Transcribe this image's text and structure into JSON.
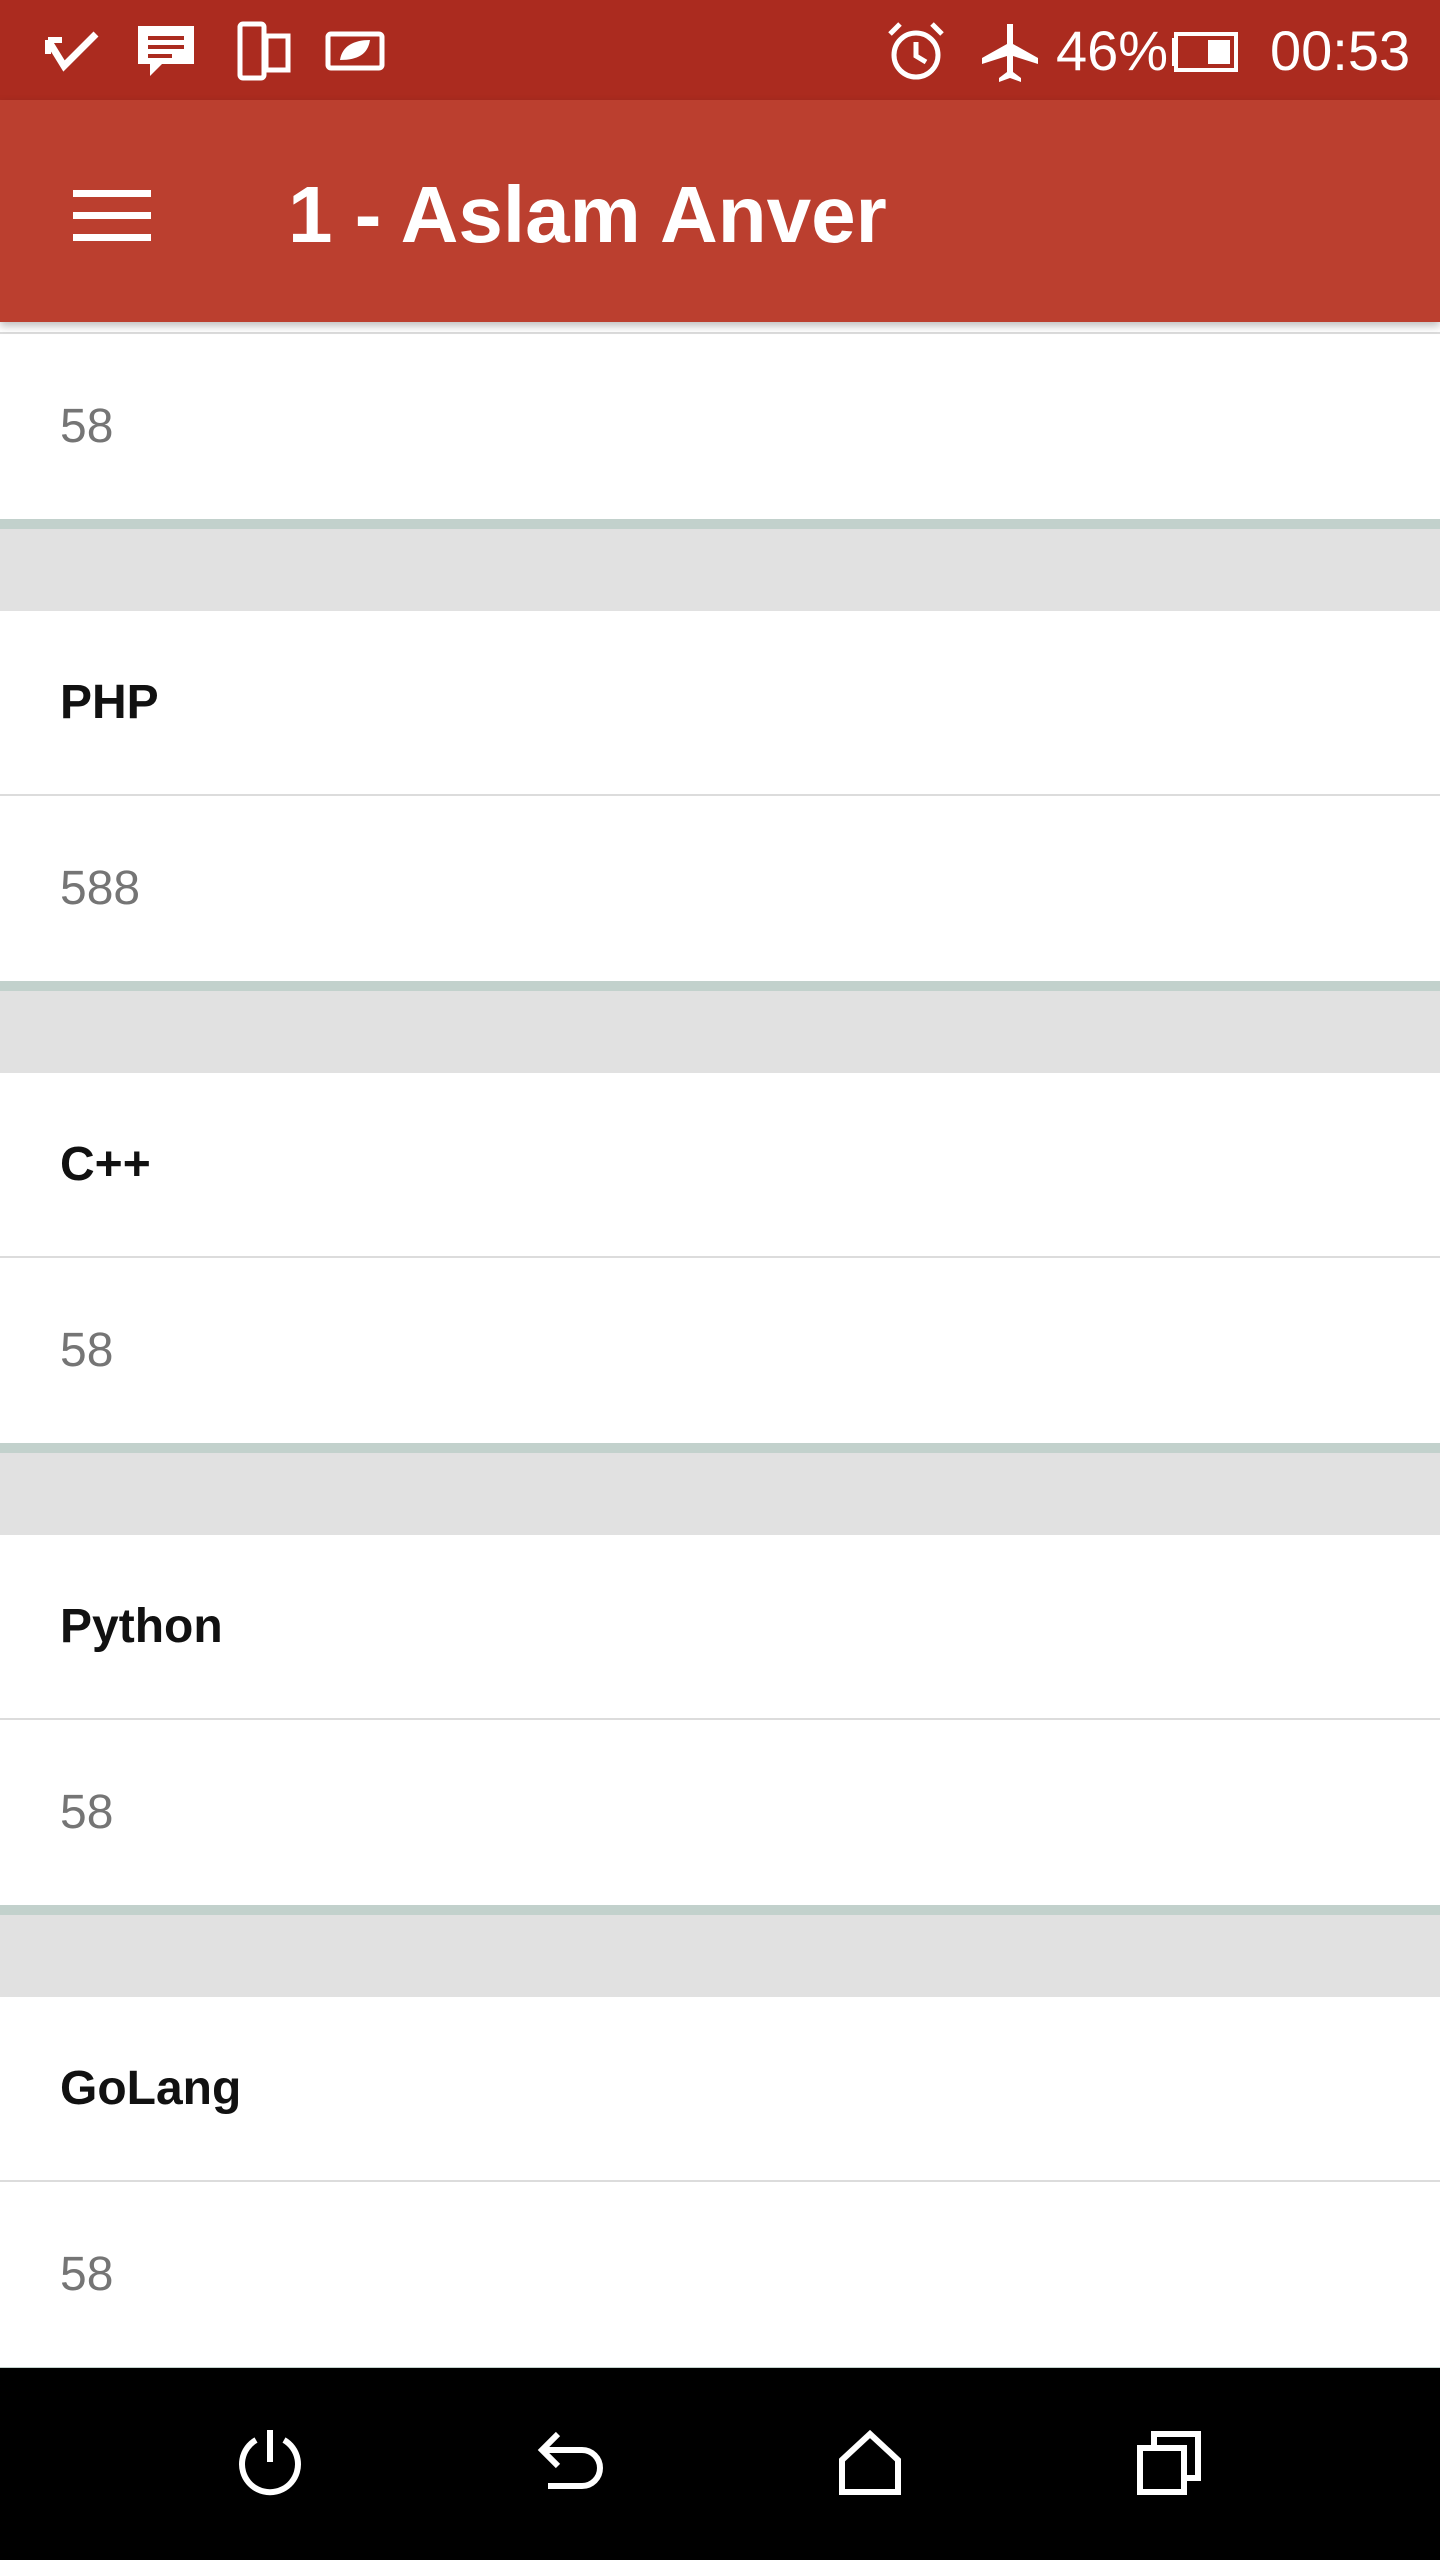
{
  "status_bar": {
    "icons": [
      "download-done-icon",
      "message-icon",
      "devices-icon",
      "power-saver-icon",
      "alarm-icon",
      "airplane-mode-icon",
      "battery-icon"
    ],
    "battery_percent": "46%",
    "battery_level": 0.46,
    "time": "00:53"
  },
  "app_bar": {
    "menu_icon": "hamburger-menu-icon",
    "title": "1 - Aslam Anver"
  },
  "list": {
    "items": [
      {
        "name": "",
        "value": "58"
      },
      {
        "name": "PHP",
        "value": "588"
      },
      {
        "name": "C++",
        "value": "58"
      },
      {
        "name": "Python",
        "value": "58"
      },
      {
        "name": "GoLang",
        "value": "58"
      }
    ]
  },
  "nav_bar": {
    "icons": [
      "power-icon",
      "back-icon",
      "home-icon",
      "recent-apps-icon"
    ]
  },
  "colors": {
    "status_bar": "#ab2b1f",
    "app_bar": "#bb3f2f",
    "card_edge": "#c2d1cc",
    "background": "#e1e1e1"
  }
}
